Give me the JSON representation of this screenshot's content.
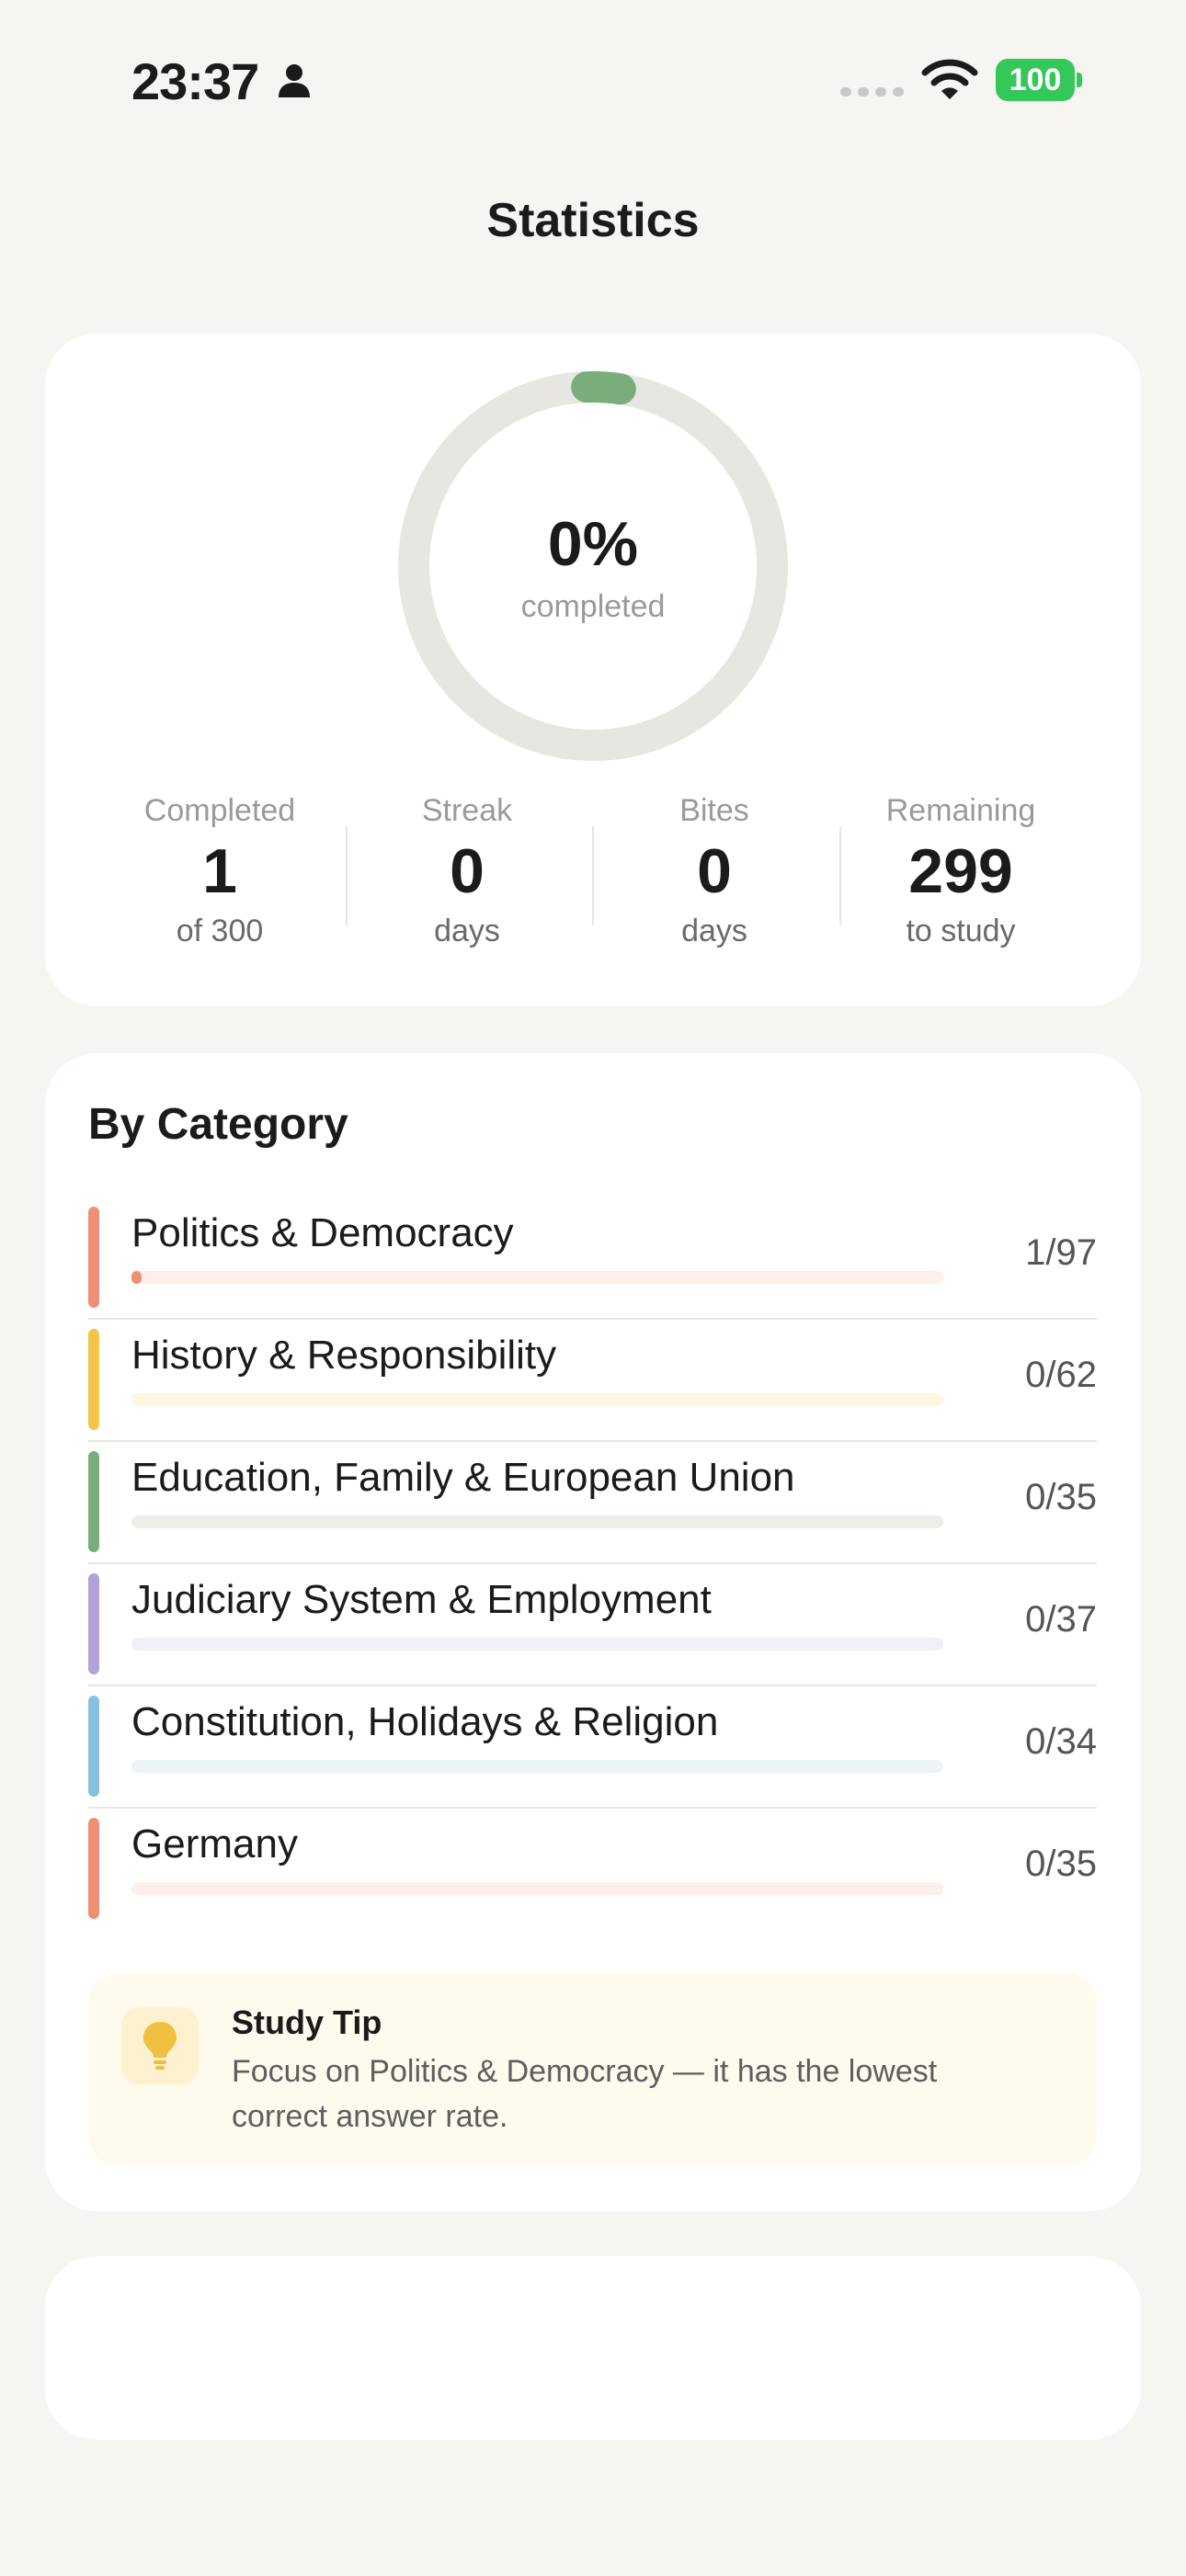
{
  "status_bar": {
    "time": "23:37",
    "battery": "100"
  },
  "page_title": "Statistics",
  "summary": {
    "progress_percent_label": "0%",
    "progress_sub": "completed",
    "progress_fraction": 0.0033,
    "stats": [
      {
        "label": "Completed",
        "value": "1",
        "sub": "of 300"
      },
      {
        "label": "Streak",
        "value": "0",
        "sub": "days"
      },
      {
        "label": "Bites",
        "value": "0",
        "sub": "days"
      },
      {
        "label": "Remaining",
        "value": "299",
        "sub": "to study"
      }
    ]
  },
  "categories_section": {
    "title": "By Category",
    "items": [
      {
        "name": "Politics & Democracy",
        "count": "1/97",
        "progress": 0.0103,
        "color": "#ef8f75",
        "track_color": "#fdefea"
      },
      {
        "name": "History & Responsibility",
        "count": "0/62",
        "progress": 0,
        "color": "#f3c64a",
        "track_color": "#fdf6e1"
      },
      {
        "name": "Education, Family & European Union",
        "count": "0/35",
        "progress": 0,
        "color": "#79ad7b",
        "track_color": "#eceeea"
      },
      {
        "name": "Judiciary System & Employment",
        "count": "0/37",
        "progress": 0,
        "color": "#b1a3d5",
        "track_color": "#f0eff5"
      },
      {
        "name": "Constitution, Holidays & Religion",
        "count": "0/34",
        "progress": 0,
        "color": "#86c0de",
        "track_color": "#edf4f8"
      },
      {
        "name": "Germany",
        "count": "0/35",
        "progress": 0,
        "color": "#ef8f75",
        "track_color": "#fdefea"
      }
    ]
  },
  "tip": {
    "icon": "lightbulb-icon",
    "title": "Study Tip",
    "text": "Focus on Politics & Democracy — it has the lowest correct answer rate."
  },
  "colors": {
    "background": "#f6f5f1",
    "card": "#ffffff",
    "ring_track": "#e8e6e0",
    "ring_progress": "#79ad7b",
    "battery": "#34c759",
    "tip_background": "#fefaec",
    "tip_icon": "#f0c040"
  }
}
